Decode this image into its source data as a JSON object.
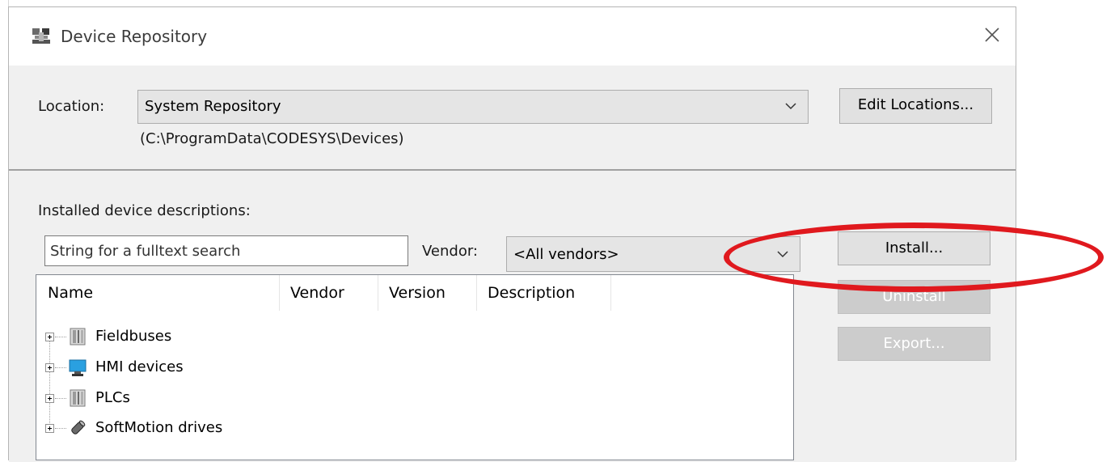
{
  "window": {
    "title": "Device Repository",
    "app_icon": "device-repository-icon",
    "close_icon": "close-icon"
  },
  "location": {
    "label": "Location:",
    "selected": "System Repository",
    "path": "(C:\\ProgramData\\CODESYS\\Devices)",
    "edit_button": "Edit Locations..."
  },
  "installed": {
    "label": "Installed device descriptions:",
    "search_placeholder": "String for a fulltext search",
    "vendor_label": "Vendor:",
    "vendor_selected": "<All vendors>"
  },
  "buttons": {
    "install": "Install...",
    "uninstall": "Uninstall",
    "export": "Export..."
  },
  "tree": {
    "columns": [
      "Name",
      "Vendor",
      "Version",
      "Description"
    ],
    "items": [
      {
        "label": "Fieldbuses",
        "icon": "fieldbus-icon"
      },
      {
        "label": "HMI devices",
        "icon": "hmi-device-icon"
      },
      {
        "label": "PLCs",
        "icon": "plc-icon"
      },
      {
        "label": "SoftMotion drives",
        "icon": "softmotion-drive-icon"
      }
    ]
  },
  "colors": {
    "highlight": "#e0191e",
    "dialog_bg": "#f0f0f0",
    "disabled_button": "#cccccc"
  }
}
